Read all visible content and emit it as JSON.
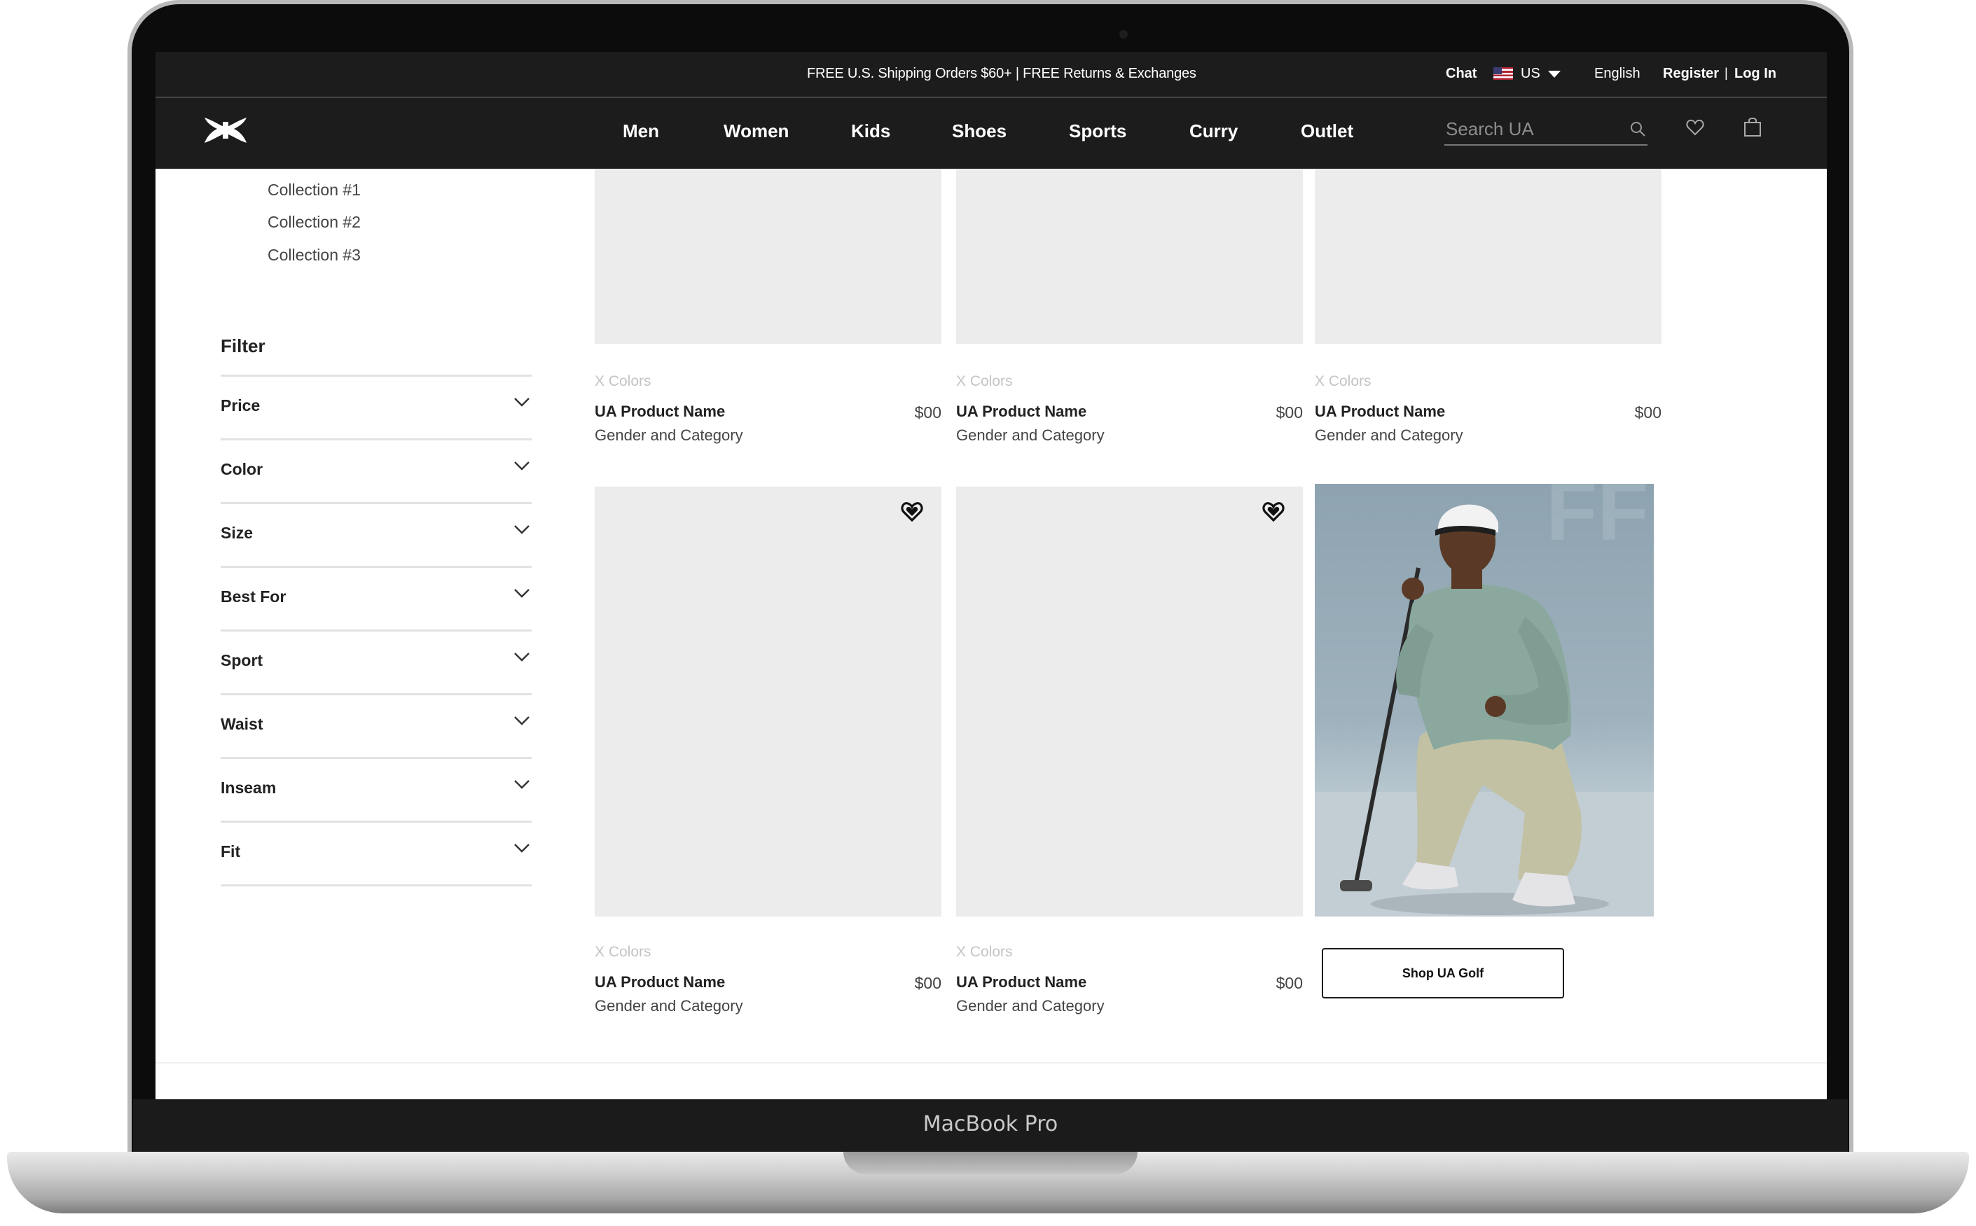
{
  "device": {
    "label": "MacBook Pro"
  },
  "promo_bar": {
    "message": "FREE U.S. Shipping Orders $60+ | FREE Returns & Exchanges",
    "chat": "Chat",
    "country": "US",
    "language": "English",
    "register": "Register",
    "separator": "|",
    "login": "Log In"
  },
  "nav": {
    "logo_icon": "under-armour-logo",
    "links": [
      "Men",
      "Women",
      "Kids",
      "Shoes",
      "Sports",
      "Curry",
      "Outlet"
    ],
    "search_placeholder": "Search UA",
    "icons": [
      "search-icon",
      "heart-icon",
      "bag-icon"
    ]
  },
  "sidebar": {
    "collections": [
      "Collection #1",
      "Collection #2",
      "Collection #3"
    ],
    "filter_title": "Filter",
    "filters": [
      "Price",
      "Color",
      "Size",
      "Best For",
      "Sport",
      "Waist",
      "Inseam",
      "Fit"
    ]
  },
  "products": [
    {
      "colors": "X Colors",
      "name": "UA Product Name",
      "category": "Gender and Category",
      "price": "$00"
    },
    {
      "colors": "X Colors",
      "name": "UA Product Name",
      "category": "Gender and Category",
      "price": "$00"
    },
    {
      "colors": "X Colors",
      "name": "UA Product Name",
      "category": "Gender and Category",
      "price": "$00"
    },
    {
      "colors": "X Colors",
      "name": "UA Product Name",
      "category": "Gender and Category",
      "price": "$00"
    },
    {
      "colors": "X Colors",
      "name": "UA Product Name",
      "category": "Gender and Category",
      "price": "$00"
    }
  ],
  "promo_tile": {
    "cta": "Shop UA Golf"
  },
  "colors": {
    "nav_background": "#1c1c1c",
    "placeholder_image": "#ececec",
    "text_primary": "#222222"
  }
}
